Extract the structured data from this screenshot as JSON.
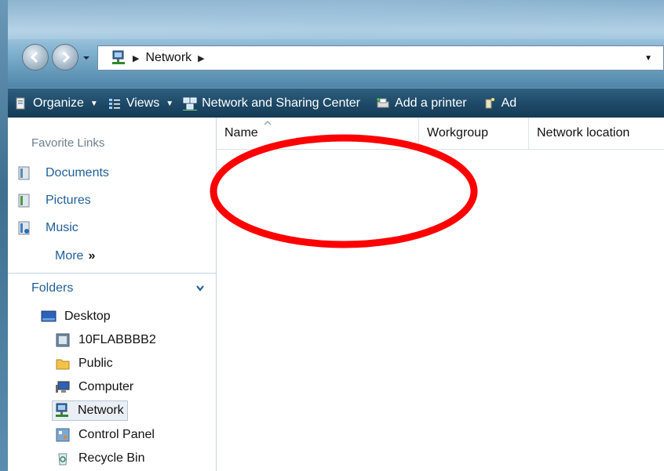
{
  "address": {
    "breadcrumb": "Network"
  },
  "toolbar": {
    "organize": "Organize",
    "views": "Views",
    "network_center": "Network and Sharing Center",
    "add_printer": "Add a printer",
    "add_partial": "Ad"
  },
  "favorites": {
    "title": "Favorite Links",
    "items": [
      "Documents",
      "Pictures",
      "Music"
    ],
    "more": "More"
  },
  "folders": {
    "title": "Folders",
    "tree": [
      "Desktop",
      "10FLABBBB2",
      "Public",
      "Computer",
      "Network",
      "Control Panel",
      "Recycle Bin"
    ],
    "selected": "Network"
  },
  "columns": {
    "name": "Name",
    "workgroup": "Workgroup",
    "network_location": "Network location"
  },
  "annotation": {
    "color": "#ff0000"
  }
}
